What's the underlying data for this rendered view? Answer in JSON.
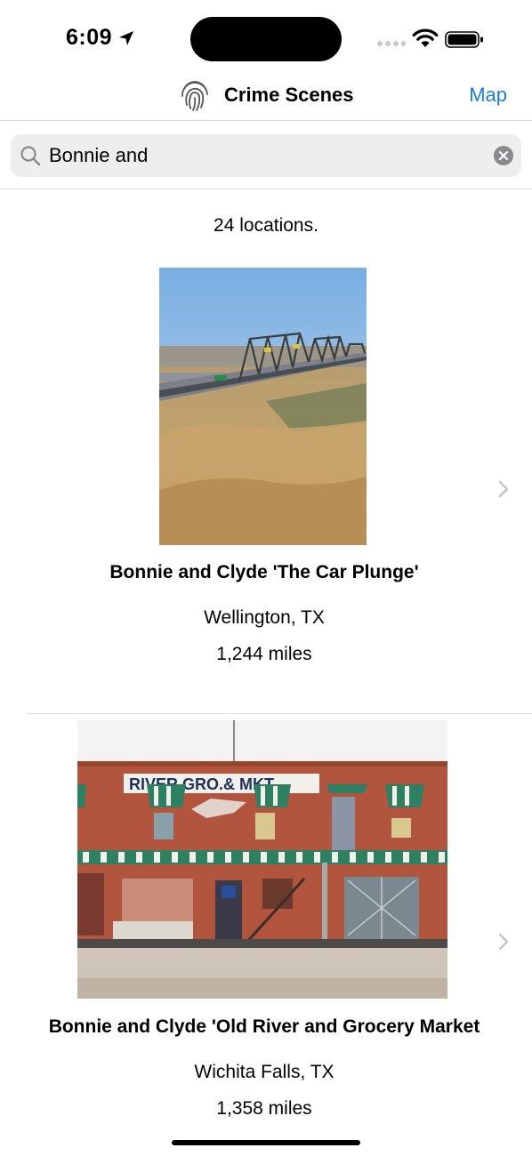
{
  "status": {
    "time": "6:09"
  },
  "nav": {
    "title": "Crime Scenes",
    "map_label": "Map"
  },
  "search": {
    "value": "Bonnie and"
  },
  "results": {
    "count_text": "24 locations.",
    "items": [
      {
        "title": "Bonnie and Clyde 'The Car Plunge'",
        "city": "Wellington, TX",
        "distance": "1,244 miles",
        "photo": "bridge over dry grass field"
      },
      {
        "title": "Bonnie and Clyde 'Old River and Grocery Market",
        "city": "Wichita Falls, TX",
        "distance": "1,358 miles",
        "photo": "brick storefront building",
        "sign_text": "RIVER GRO.& MKT."
      }
    ]
  },
  "colors": {
    "accent": "#1a7fd8",
    "search_bg": "#eeeeef",
    "separator": "#e0e0e3"
  }
}
